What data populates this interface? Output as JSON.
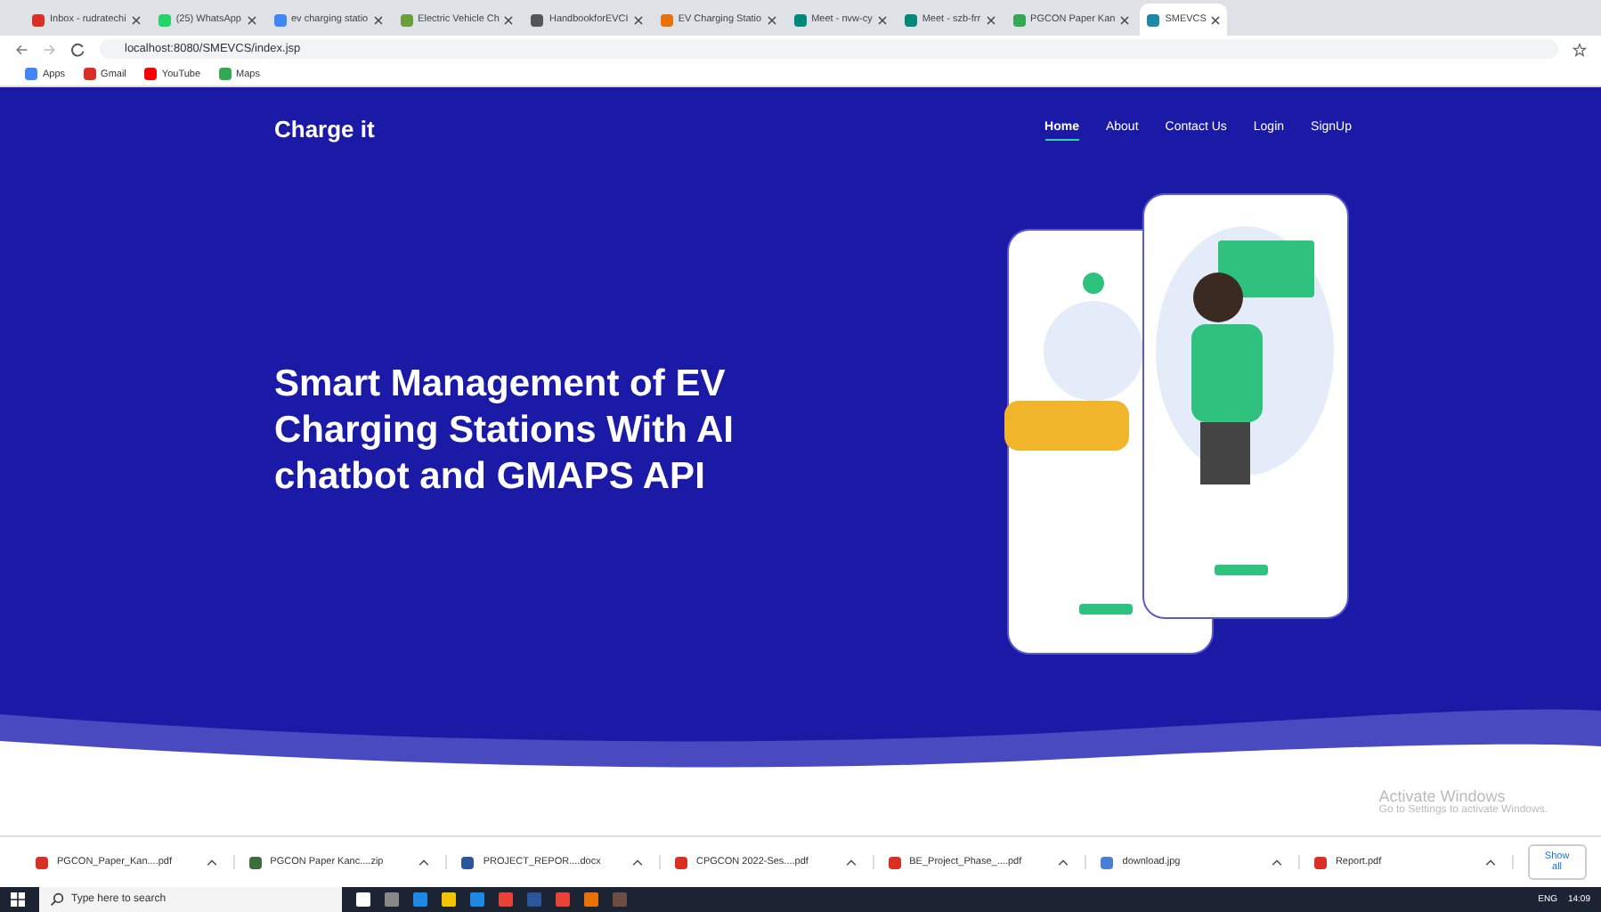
{
  "browser": {
    "tabs": [
      {
        "title": "Inbox - rudratechi",
        "selected": false
      },
      {
        "title": "(25) WhatsApp",
        "selected": false
      },
      {
        "title": "ev charging statio",
        "selected": false
      },
      {
        "title": "Electric Vehicle Ch",
        "selected": false
      },
      {
        "title": "HandbookforEVCI",
        "selected": false
      },
      {
        "title": "EV Charging Statio",
        "selected": false
      },
      {
        "title": "Meet - nvw-cy",
        "selected": false
      },
      {
        "title": "Meet - szb-frr",
        "selected": false
      },
      {
        "title": "PGCON Paper Kan",
        "selected": false
      },
      {
        "title": "SMEVCS",
        "selected": true
      }
    ],
    "address": "localhost:8080/SMEVCS/index.jsp",
    "bookmarks": [
      "Apps",
      "Gmail",
      "YouTube",
      "Maps"
    ]
  },
  "site": {
    "brand": "Charge it",
    "nav": [
      {
        "label": "Home",
        "selected": true
      },
      {
        "label": "About",
        "selected": false
      },
      {
        "label": "Contact Us",
        "selected": false
      },
      {
        "label": "Login",
        "selected": false
      },
      {
        "label": "SignUp",
        "selected": false
      }
    ],
    "headline": "Smart Management of EV Charging Stations With AI chatbot and GMAPS API"
  },
  "activation": {
    "title": "Activate Windows",
    "subtitle": "Go to Settings to activate Windows."
  },
  "downloads": {
    "files": [
      {
        "name": "PGCON_Paper_Kan....pdf",
        "kind": "pdf"
      },
      {
        "name": "PGCON Paper Kanc....zip",
        "kind": "zip"
      },
      {
        "name": "PROJECT_REPOR....docx",
        "kind": "doc"
      },
      {
        "name": "CPGCON 2022-Ses....pdf",
        "kind": "pdf"
      },
      {
        "name": "BE_Project_Phase_....pdf",
        "kind": "pdf"
      },
      {
        "name": "download.jpg",
        "kind": "img"
      },
      {
        "name": "Report.pdf",
        "kind": "pdf"
      }
    ],
    "show_all": "Show all"
  },
  "taskbar": {
    "search_placeholder": "Type here to search",
    "language": "ENG",
    "time": "14:09"
  }
}
